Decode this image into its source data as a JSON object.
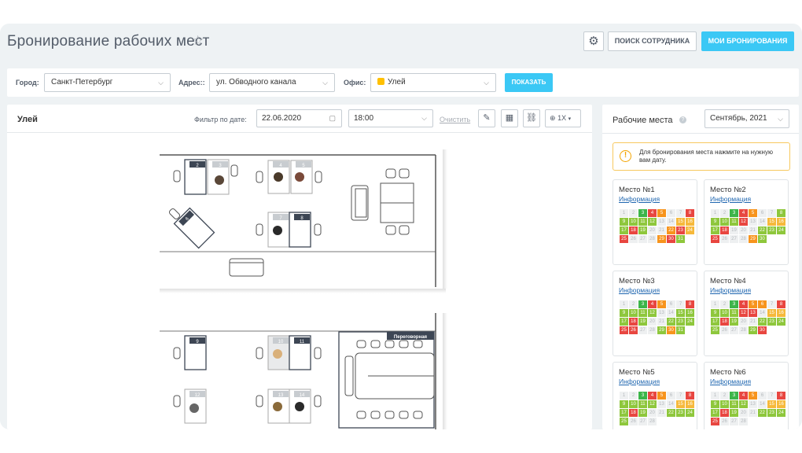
{
  "header": {
    "title": "Бронирование рабочих мест",
    "search_employee": "ПОИСК СОТРУДНИКА",
    "my_bookings": "МОИ БРОНИРОВАНИЯ"
  },
  "filters": {
    "city_label": "Город:",
    "city_value": "Санкт-Петербург",
    "address_label": "Адрес::",
    "address_value": "ул. Обводного канала",
    "office_label": "Офис:",
    "office_value": "Улей",
    "show_button": "ПОКАЗАТЬ"
  },
  "plan": {
    "title": "Улей",
    "date_filter_label": "Фильтр по дате:",
    "date_value": "22.06.2020",
    "time_value": "18:00",
    "clear_label": "Очистить",
    "zoom_value": "1X",
    "meeting_room_label": "Переговорная",
    "desks": [
      "2",
      "3",
      "4",
      "5",
      "6",
      "7",
      "8",
      "9",
      "10",
      "11",
      "12",
      "13",
      "14"
    ]
  },
  "workplaces": {
    "title": "Рабочие места",
    "month": "Сентябрь, 2021",
    "notice": "Для бронирования места нажмите на нужную вам дату.",
    "info_label": "Информация",
    "places": [
      "Место №1",
      "Место №2",
      "Место №3",
      "Место №4",
      "Место №5",
      "Место №6"
    ]
  },
  "colors": {
    "accent": "#3bc8f5",
    "free": "#8ec73c",
    "busy": "#e84640",
    "partial": "#f7941d",
    "link": "#2067b0"
  }
}
